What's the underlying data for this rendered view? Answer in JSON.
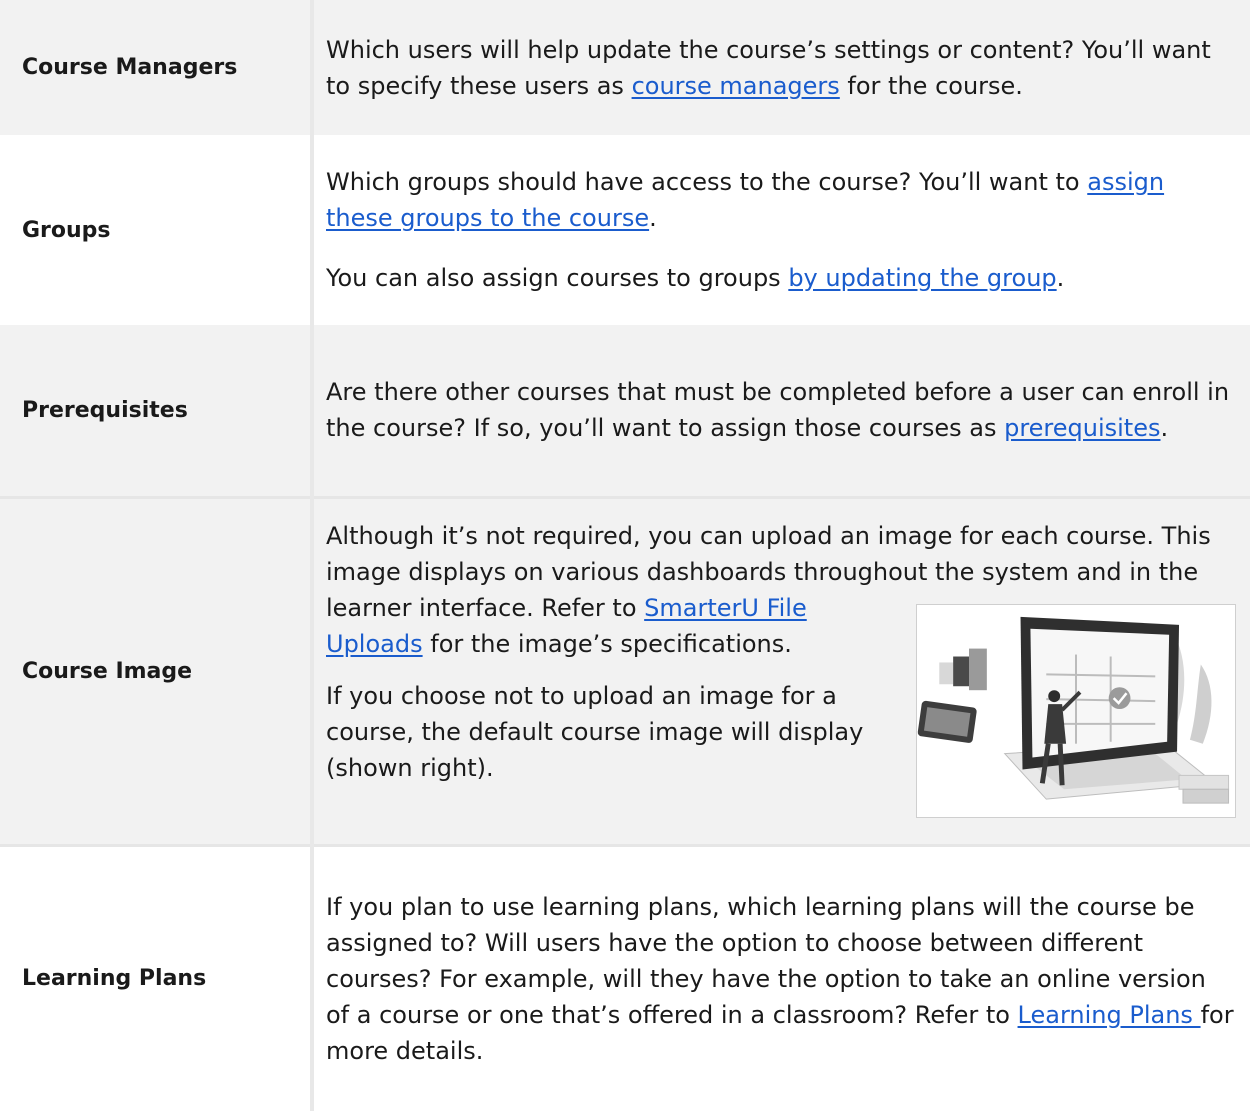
{
  "rows": [
    {
      "label": "Course Managers",
      "text": {
        "t1": "Which users will help update the course’s settings or content? You’ll want to specify these users as ",
        "link1": "course managers",
        "t2": " for the course."
      }
    },
    {
      "label": "Groups",
      "p1": {
        "t1": "Which groups should have access to the course? You’ll want to ",
        "link1": "assign these groups to the course",
        "t2": "."
      },
      "p2": {
        "t1": "You can also assign courses to groups ",
        "link1": "by updating the group",
        "t2": "."
      }
    },
    {
      "label": "Prerequisites",
      "text": {
        "t1": "Are there other courses that must be completed before a user can enroll in the course? If so, you’ll want to assign those courses as ",
        "link1": "prerequisites",
        "t2": "."
      }
    },
    {
      "label": "Course Image",
      "p1": {
        "t1": "Although it’s not required, you can upload an image for each course. This image displays on various dashboards throughout the system and in the learner interface. Refer to ",
        "link1": "SmarterU File Uploads",
        "t2": " for the image’s specifications."
      },
      "p2": {
        "t1": "If you choose not to upload an image for a course, the default course image will display (shown right)."
      }
    },
    {
      "label": "Learning Plans",
      "text": {
        "t1": "If you plan to use learning plans, which learning plans will the course be assigned to? Will users have the option to choose between different courses? For example, will they have the option to take an online version of a course or one that’s offered in a classroom? Refer to ",
        "link1": "Learning Plans ",
        "t2": "for more details."
      }
    }
  ],
  "colors": {
    "link": "#1a5ccd",
    "shade": "#f2f2f2",
    "border": "#e8e8e8"
  }
}
